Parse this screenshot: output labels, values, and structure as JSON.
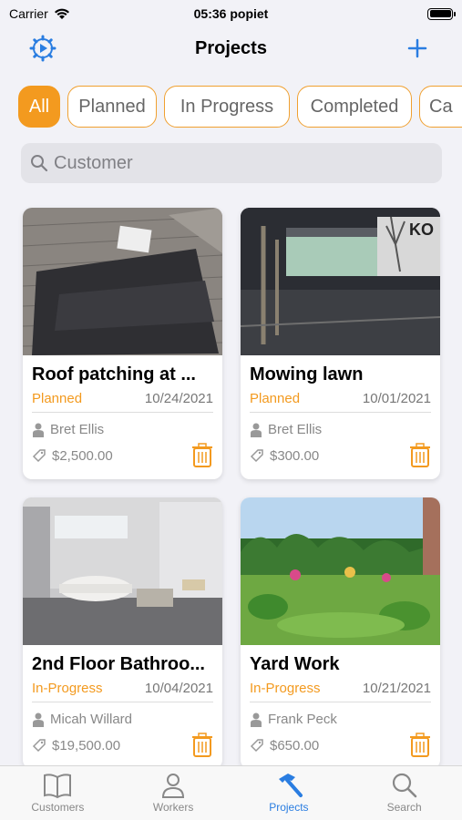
{
  "status_bar": {
    "carrier": "Carrier",
    "time": "05:36 popiet"
  },
  "nav": {
    "title": "Projects"
  },
  "filters": [
    "All",
    "Planned",
    "In Progress",
    "Completed",
    "Ca"
  ],
  "search": {
    "placeholder": "Customer"
  },
  "colors": {
    "accent": "#f39a1f",
    "tint": "#2a7de1"
  },
  "projects": [
    {
      "name": "Roof patching at ...",
      "status": "Planned",
      "date": "10/24/2021",
      "person": "Bret  Ellis",
      "price": "$2,500.00",
      "image": "roof-image"
    },
    {
      "name": "Mowing lawn",
      "status": "Planned",
      "date": "10/01/2021",
      "person": "Bret  Ellis",
      "price": "$300.00",
      "image": "parking-lot-image"
    },
    {
      "name": "2nd Floor Bathroo...",
      "status": "In-Progress",
      "date": "10/04/2021",
      "person": "Micah  Willard",
      "price": "$19,500.00",
      "image": "bathroom-image"
    },
    {
      "name": "Yard Work",
      "status": "In-Progress",
      "date": "10/21/2021",
      "person": "Frank  Peck",
      "price": "$650.00",
      "image": "garden-image"
    }
  ],
  "tabs": [
    {
      "label": "Customers",
      "icon": "book-icon"
    },
    {
      "label": "Workers",
      "icon": "person-icon"
    },
    {
      "label": "Projects",
      "icon": "hammer-icon",
      "active": true
    },
    {
      "label": "Search",
      "icon": "search-icon"
    }
  ]
}
